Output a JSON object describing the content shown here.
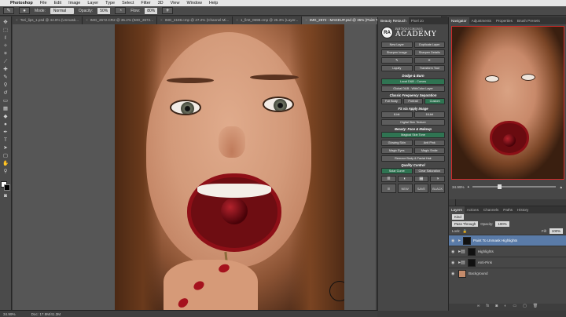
{
  "menubar": {
    "apple": "",
    "app": "Photoshop",
    "items": [
      "File",
      "Edit",
      "Image",
      "Layer",
      "Type",
      "Select",
      "Filter",
      "3D",
      "View",
      "Window",
      "Help"
    ]
  },
  "options": {
    "mode_label": "Mode:",
    "mode_value": "Normal",
    "opacity_label": "Opacity:",
    "opacity_value": "50%",
    "flow_label": "Flow:",
    "flow_value": "80%"
  },
  "tabs": [
    {
      "label": "Tori_lips_1.psd @ 44.9% (Unmask..."
    },
    {
      "label": "IMG_2672.CR2 @ 35.2% (IMG_2672..."
    },
    {
      "label": "IMG_3198.cmp @ 47.2% (Channel Mi..."
    },
    {
      "label": "1_first_0698.cmp @ 25.3% (Layer..."
    },
    {
      "label": "IMG_2672 - MAKEUP.psd @ 35% (Paint To Unmask Highlights, Layer Mask/8) *",
      "active": true
    }
  ],
  "status": {
    "zoom": "34.99%",
    "doc": "Doc: 17.8M/41.3M"
  },
  "beauty_panel": {
    "tabs": [
      "Beauty Retouch",
      "Pixel Jo"
    ],
    "logo_badge": "RA",
    "logo_top": "RETOUCHING",
    "logo_big": "ACADEMY",
    "buttons_top": [
      "New Layer",
      "Duplicate Layer",
      "Sharpen Image",
      "Sharpen Details",
      "",
      "",
      "Liquify",
      "Transform Tool"
    ],
    "dodge_title": "Dodge & Burn",
    "dodge_buttons": [
      "Local D&B - Curves",
      "Global D&B - WithColor Layer"
    ],
    "freq_title": "Classic Frequency Separation",
    "freq_buttons": [
      "Full Body",
      "Portrait",
      "Custom"
    ],
    "fs_title": "FS via Apply Image",
    "fs_buttons": [
      "8-bit",
      "16-bit"
    ],
    "digital_button": "Digital Skin Texture",
    "makeup_title": "Beauty: Face & Makeup",
    "makeup_main": "Magical Skin Tone",
    "makeup_buttons": [
      "Glowing Skin",
      "Anti Pink",
      "Magic Eyes",
      "Magic Smile"
    ],
    "remove_button": "Remove Body & Facial Hair",
    "quality_title": "Quality Control",
    "quality_buttons": [
      "Solar Curve",
      "Clear Saturation"
    ],
    "icon_row_labels": [
      "NEW",
      "SAVE",
      "BLACK",
      "SAVE"
    ]
  },
  "icon_col": {
    "items": [
      "RA",
      "RA"
    ]
  },
  "navigator": {
    "tabs": [
      "Navigator",
      "Adjustments",
      "Properties",
      "Brush Presets"
    ],
    "zoom": "34.99%"
  },
  "layers_panel": {
    "tabs": [
      "Layers",
      "Actions",
      "Channels",
      "Paths",
      "History"
    ],
    "kind_label": "Kind",
    "blend_mode": "Pass Through",
    "opacity_label": "Opacity:",
    "opacity_value": "100%",
    "lock_label": "Lock:",
    "fill_label": "Fill:",
    "fill_value": "100%",
    "layers": [
      {
        "name": "Paint To Unmask Highlights",
        "selected": true,
        "type": "masked"
      },
      {
        "name": "Highlights",
        "selected": false,
        "type": "group"
      },
      {
        "name": "Anti-Pink",
        "selected": false,
        "type": "group"
      },
      {
        "name": "Background",
        "selected": false,
        "type": "image"
      }
    ]
  },
  "colors": {
    "accent_green": "#2f7452",
    "selection_blue": "#5a7ba8",
    "navigator_frame": "#d42a2a"
  }
}
